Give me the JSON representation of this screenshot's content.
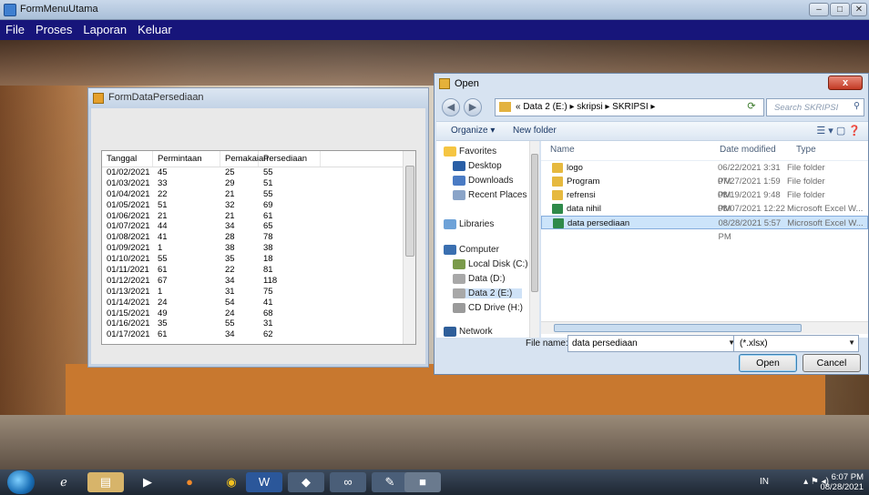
{
  "window": {
    "title": "FormMenuUtama"
  },
  "menubar": {
    "items": [
      "File",
      "Proses",
      "Laporan",
      "Keluar"
    ]
  },
  "form_persediaan": {
    "title": "FormDataPersediaan",
    "columns": [
      "Tanggal",
      "Permintaan",
      "Pemakaian",
      "Persediaan"
    ],
    "rows": [
      [
        "01/02/2021",
        "45",
        "25",
        "55"
      ],
      [
        "01/03/2021",
        "33",
        "29",
        "51"
      ],
      [
        "01/04/2021",
        "22",
        "21",
        "55"
      ],
      [
        "01/05/2021",
        "51",
        "32",
        "69"
      ],
      [
        "01/06/2021",
        "21",
        "21",
        "61"
      ],
      [
        "01/07/2021",
        "44",
        "34",
        "65"
      ],
      [
        "01/08/2021",
        "41",
        "28",
        "78"
      ],
      [
        "01/09/2021",
        "1",
        "38",
        "38"
      ],
      [
        "01/10/2021",
        "55",
        "35",
        "18"
      ],
      [
        "01/11/2021",
        "61",
        "22",
        "81"
      ],
      [
        "01/12/2021",
        "67",
        "34",
        "118"
      ],
      [
        "01/13/2021",
        "1",
        "31",
        "75"
      ],
      [
        "01/14/2021",
        "24",
        "54",
        "41"
      ],
      [
        "01/15/2021",
        "49",
        "24",
        "68"
      ],
      [
        "01/16/2021",
        "35",
        "55",
        "31"
      ],
      [
        "01/17/2021",
        "61",
        "34",
        "62"
      ]
    ]
  },
  "open_dialog": {
    "title": "Open",
    "close_label": "x",
    "breadcrumb": "« Data 2 (E:) ▸ skripsi ▸ SKRIPSI ▸",
    "search_placeholder": "Search SKRIPSI",
    "organize_label": "Organize ▾",
    "new_folder_label": "New folder",
    "nav": {
      "favorites": "Favorites",
      "desktop": "Desktop",
      "downloads": "Downloads",
      "recent": "Recent Places",
      "libraries": "Libraries",
      "computer": "Computer",
      "local_disk": "Local Disk (C:)",
      "data_d": "Data (D:)",
      "data2_e": "Data 2 (E:)",
      "cd_drive": "CD Drive (H:)",
      "network": "Network"
    },
    "columns": [
      "Name",
      "Date modified",
      "Type"
    ],
    "files": [
      {
        "name": "logo",
        "date": "06/22/2021 3:31 PM",
        "type": "File folder",
        "kind": "folder"
      },
      {
        "name": "Program",
        "date": "07/27/2021 1:59 PM",
        "type": "File folder",
        "kind": "folder"
      },
      {
        "name": "refrensi",
        "date": "08/19/2021 9:48 PM",
        "type": "File folder",
        "kind": "folder"
      },
      {
        "name": "data nihil",
        "date": "08/07/2021 12:22 ...",
        "type": "Microsoft Excel W...",
        "kind": "excel"
      },
      {
        "name": "data persediaan",
        "date": "08/28/2021 5:57 PM",
        "type": "Microsoft Excel W...",
        "kind": "excel"
      }
    ],
    "filename_label": "File name:",
    "filename_value": "data persediaan",
    "filetype_value": "(*.xlsx)",
    "open_label": "Open",
    "cancel_label": "Cancel"
  },
  "taskbar": {
    "lang": "IN",
    "time": "6:07 PM",
    "date": "08/28/2021"
  }
}
